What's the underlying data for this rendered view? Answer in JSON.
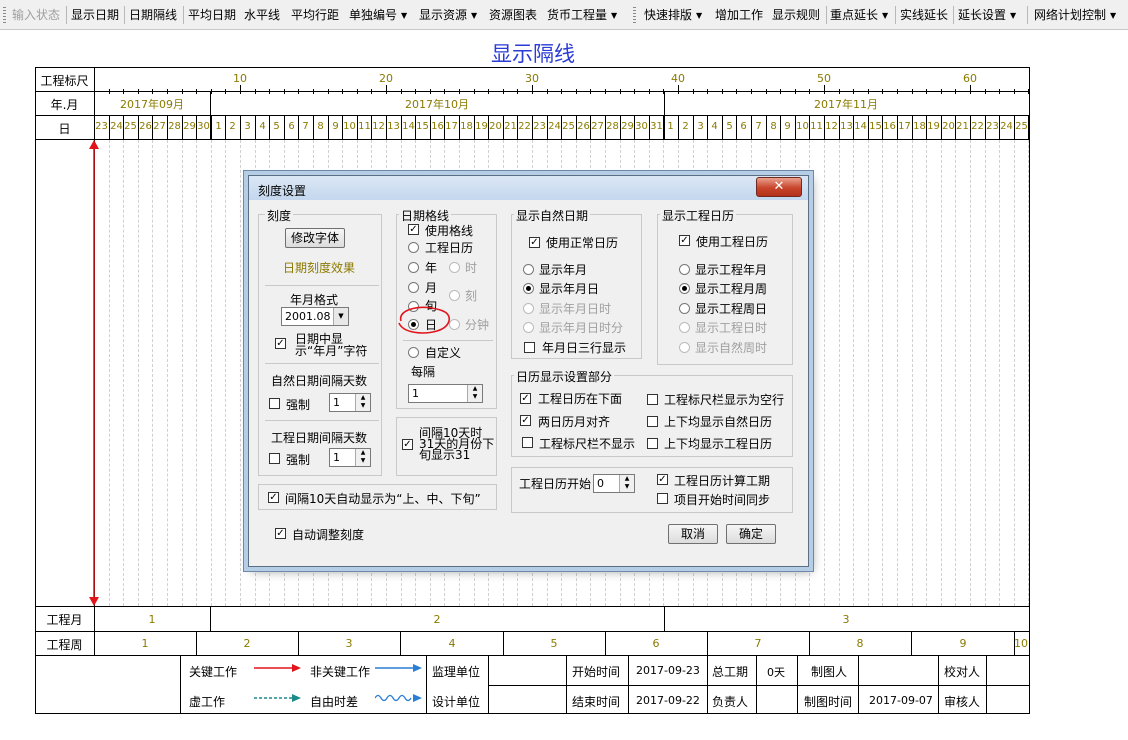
{
  "toolbar": {
    "items": [
      {
        "label": "输入状态",
        "disabled": true
      },
      {
        "label": "显示日期"
      },
      {
        "label": "日期隔线"
      },
      {
        "label": "平均日期"
      },
      {
        "label": "水平线"
      },
      {
        "label": "平均行距"
      },
      {
        "label": "单独编号",
        "dropdown": true
      },
      {
        "label": "显示资源",
        "dropdown": true
      },
      {
        "label": "资源图表"
      },
      {
        "label": "货币工程量",
        "dropdown": true
      },
      {
        "label": "快速排版",
        "dropdown": true
      },
      {
        "label": "增加工作"
      },
      {
        "label": "显示规则"
      },
      {
        "label": "重点延长",
        "dropdown": true
      },
      {
        "label": "实线延长"
      },
      {
        "label": "延长设置",
        "dropdown": true
      },
      {
        "label": "网络计划控制",
        "dropdown": true
      }
    ]
  },
  "document": {
    "title": "显示隔线",
    "row_labels": {
      "ruler": "工程标尺",
      "year_month": "年.月",
      "day": "日",
      "project_month": "工程月",
      "project_week": "工程周"
    },
    "ruler_numbers": [
      "10",
      "20",
      "30",
      "40",
      "50",
      "60"
    ],
    "months": [
      "2017年09月",
      "2017年10月",
      "2017年11月"
    ],
    "days_sep": [
      "23",
      "24",
      "25",
      "26",
      "27",
      "28",
      "29",
      "30"
    ],
    "days_oct": [
      "1",
      "2",
      "3",
      "4",
      "5",
      "6",
      "7",
      "8",
      "9",
      "10",
      "11",
      "12",
      "13",
      "14",
      "15",
      "16",
      "17",
      "18",
      "19",
      "20",
      "21",
      "22",
      "23",
      "24",
      "25",
      "26",
      "27",
      "28",
      "29",
      "30",
      "31"
    ],
    "days_nov": [
      "1",
      "2",
      "3",
      "4",
      "5",
      "6",
      "7",
      "8",
      "9",
      "10",
      "11",
      "12",
      "13",
      "14",
      "15",
      "16",
      "17",
      "18",
      "19",
      "20",
      "21",
      "22",
      "23",
      "24",
      "25"
    ],
    "project_months": [
      "1",
      "2",
      "3"
    ],
    "project_weeks": [
      "1",
      "2",
      "3",
      "4",
      "5",
      "6",
      "7",
      "8",
      "9",
      "10"
    ],
    "legend": {
      "critical_work": "关键工作",
      "non_critical_work": "非关键工作",
      "dummy_work": "虚工作",
      "free_float": "自由时差"
    },
    "info": {
      "supervisor_label": "监理单位",
      "supervisor_value": "",
      "designer_label": "设计单位",
      "designer_value": "",
      "start_label": "开始时间",
      "start_value": "2017-09-23",
      "end_label": "结束时间",
      "end_value": "2017-09-22",
      "total_label": "总工期",
      "total_value": "0天",
      "owner_label": "负责人",
      "owner_value": "",
      "drafter_label": "制图人",
      "drafter_value": "",
      "draw_time_label": "制图时间",
      "draw_time_value": "2017-09-07",
      "checker_label": "校对人",
      "checker_value": "",
      "reviewer_label": "审核人",
      "reviewer_value": ""
    },
    "colors": {
      "title": "#2a3bd6",
      "scale_text": "#8b7a00",
      "critical": "#e0141a",
      "non_critical": "#2a7fd4",
      "dummy": "#1d8a8a"
    }
  },
  "dialog": {
    "title": "刻度设置",
    "close_label": "✕",
    "scale_group": {
      "title": "刻度",
      "modify_font": "修改字体",
      "effect": "日期刻度效果",
      "ym_format_label": "年月格式",
      "ym_format_value": "2001.08",
      "show_ym_in_date": "日期中显示“年月”字符",
      "show_ym_in_date_checked": true,
      "natural_interval_title": "自然日期间隔天数",
      "natural_force": "强制",
      "natural_force_checked": false,
      "natural_value": "1",
      "project_interval_title": "工程日期间隔天数",
      "project_force": "强制",
      "project_force_checked": false,
      "project_value": "1",
      "auto_xun": "间隔10天自动显示为“上、中、下旬”",
      "auto_xun_checked": true,
      "auto_adjust": "自动调整刻度",
      "auto_adjust_checked": true
    },
    "gridline_group": {
      "title": "日期格线",
      "use_gridline": "使用格线",
      "use_gridline_checked": true,
      "project_calendar": "工程日历",
      "year": "年",
      "hour": "时",
      "month": "月",
      "xun": "旬",
      "ke": "刻",
      "day": "日",
      "minute": "分钟",
      "custom": "自定义",
      "every": "每隔",
      "every_value": "1",
      "selected": "day",
      "last_day_note": "间隔10天时31天的月份下旬显示31",
      "last_day_note_checked": true
    },
    "natural_date_group": {
      "title": "显示自然日期",
      "use_normal_calendar": "使用正常日历",
      "use_normal_calendar_checked": true,
      "show_ym": "显示年月",
      "show_ymd": "显示年月日",
      "show_ymdh": "显示年月日时",
      "show_ymdhm": "显示年月日时分",
      "three_rows": "年月日三行显示",
      "three_rows_checked": false,
      "selected": "show_ymd"
    },
    "project_calendar_group": {
      "title": "显示工程日历",
      "use_project_calendar": "使用工程日历",
      "use_project_calendar_checked": true,
      "show_pym": "显示工程年月",
      "show_pmw": "显示工程月周",
      "show_pwd": "显示工程周日",
      "show_pdh": "显示工程日时",
      "show_natural_week": "显示自然周时",
      "selected": "show_pmw"
    },
    "calendar_display_group": {
      "title": "日历显示设置部分",
      "project_below": "工程日历在下面",
      "project_below_checked": true,
      "ruler_blank": "工程标尺栏显示为空行",
      "ruler_blank_checked": false,
      "align": "两日历月对齐",
      "align_checked": true,
      "both_natural": "上下均显示自然日历",
      "both_natural_checked": false,
      "ruler_hide": "工程标尺栏不显示",
      "ruler_hide_checked": false,
      "both_project": "上下均显示工程日历",
      "both_project_checked": false
    },
    "start_group": {
      "label": "工程日历开始",
      "value": "0",
      "calc_period": "工程日历计算工期",
      "calc_period_checked": true,
      "sync_start": "项目开始时间同步",
      "sync_start_checked": false
    },
    "buttons": {
      "cancel": "取消",
      "ok": "确定"
    }
  }
}
